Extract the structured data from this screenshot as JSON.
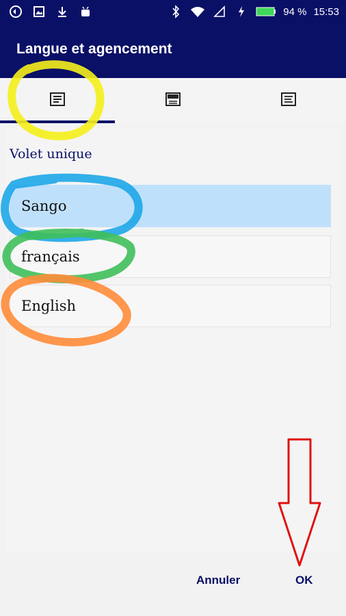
{
  "status_bar": {
    "battery": "94 %",
    "time": "15:53",
    "icons_left": [
      "app-icon",
      "image-icon",
      "download-icon",
      "android-icon"
    ],
    "icons_right": [
      "bluetooth-icon",
      "wifi-icon",
      "signal-icon",
      "charging-icon",
      "battery-icon"
    ]
  },
  "app_bar": {
    "title": "Langue et agencement"
  },
  "tabs": [
    {
      "icon": "single-pane-icon",
      "selected": true
    },
    {
      "icon": "split-pane-icon",
      "selected": false
    },
    {
      "icon": "text-pane-icon",
      "selected": false
    }
  ],
  "section": {
    "title": "Volet unique"
  },
  "languages": [
    {
      "label": "Sango",
      "selected": true
    },
    {
      "label": "français",
      "selected": false
    },
    {
      "label": "English",
      "selected": false
    }
  ],
  "footer": {
    "cancel_label": "Annuler",
    "ok_label": "OK"
  },
  "colors": {
    "primary": "#0a1066",
    "selected_bg": "#bfe0fb",
    "annotation_yellow": "#f5ef1a",
    "annotation_blue": "#1ea7e8",
    "annotation_green": "#3fbf5a",
    "annotation_orange": "#ff8c3a",
    "annotation_red": "#e01010"
  }
}
